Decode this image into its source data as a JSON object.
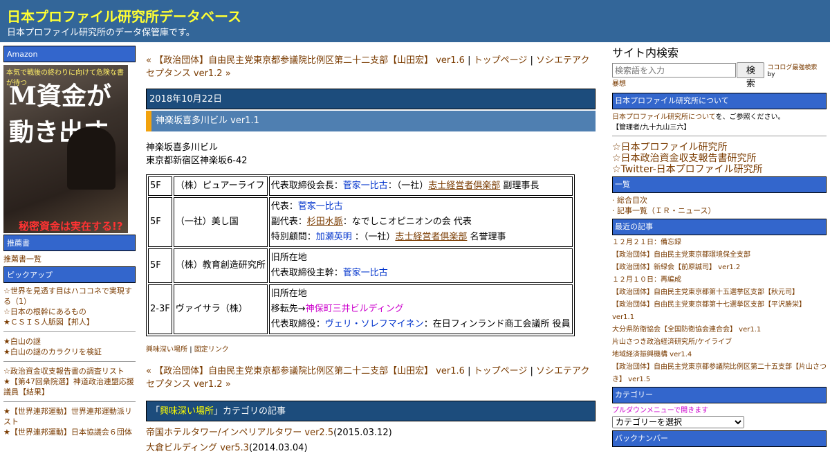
{
  "header": {
    "title": "日本プロファイル研究所データベース",
    "description": "日本プロファイル研究所のデータ保管庫です。"
  },
  "left_sidebar": {
    "amazon_heading": "Amazon",
    "book_cover": {
      "top_caption": "本気で戦後の終わりに向けて危険な書が待つ",
      "title": "M資金が動き出す",
      "bottom_caption": "秘密資金は実在する!?"
    },
    "recommend_heading": "推薦書",
    "recommend_link": "推薦書一覧",
    "pickup_heading": "ピックアップ",
    "pickup_group1": [
      "☆世界を見透す目はハココネで実現する（1）",
      "☆日本の根幹にあるもの",
      "★ＣＳＩＳ人脈図【邦人】"
    ],
    "pickup_group2": [
      "★白山の謎",
      "★白山の謎のカラクリを検証"
    ],
    "pickup_group3": [
      "☆政治資金収支報告書の調査リスト",
      "★【第47回衆院選】神道政治連盟応援議員【結果】"
    ],
    "pickup_group4": [
      "★【世界連邦運動】世界連邦運動派リスト",
      "★【世界連邦運動】日本協議会６団体"
    ]
  },
  "main": {
    "nav": {
      "prev_link": "« 【政治団体】自由民主党東京都参議院比例区第二十二支部【山田宏】 ver1.6",
      "separator": " | ",
      "top_link": "トップページ",
      "next_link": "ソシエテアクセプタンス ver1.2 »"
    },
    "date": "2018年10月22日",
    "entry_title": "神楽坂喜多川ビル ver1.1",
    "building_name": "神楽坂喜多川ビル",
    "address": "東京都新宿区神楽坂6-42",
    "rows": [
      {
        "floor": "5F",
        "tenant": "（株）ピュアーライフ",
        "lines": [
          {
            "parts": [
              {
                "t": "代表取締役会長："
              },
              {
                "t": "菅家一比古",
                "c": "blue"
              },
              {
                "t": "：（一社）"
              },
              {
                "t": "志士経営者倶楽部",
                "c": "brown"
              },
              {
                "t": " 副理事長"
              }
            ]
          }
        ]
      },
      {
        "floor": "5F",
        "tenant": "（一社）美し国",
        "lines": [
          {
            "parts": [
              {
                "t": "代表："
              },
              {
                "t": "菅家一比古",
                "c": "blue"
              }
            ]
          },
          {
            "parts": [
              {
                "t": "副代表："
              },
              {
                "t": "杉田水脈",
                "c": "brown"
              },
              {
                "t": "：なでしこオピニオンの会 代表"
              }
            ]
          },
          {
            "parts": [
              {
                "t": "特別顧問："
              },
              {
                "t": "加瀬英明",
                "c": "blue"
              },
              {
                "t": " ：（一社）"
              },
              {
                "t": "志士経営者倶楽部",
                "c": "brown"
              },
              {
                "t": " 名誉理事"
              }
            ]
          }
        ]
      },
      {
        "floor": "5F",
        "tenant": "（株）教育創造研究所",
        "lines": [
          {
            "parts": [
              {
                "t": "旧所在地"
              }
            ]
          },
          {
            "parts": [
              {
                "t": "代表取締役主幹："
              },
              {
                "t": "菅家一比古",
                "c": "blue"
              }
            ]
          }
        ]
      },
      {
        "floor": "2-3F",
        "tenant": "ヴァイサラ（株）",
        "lines": [
          {
            "parts": [
              {
                "t": "旧所在地"
              }
            ]
          },
          {
            "parts": [
              {
                "t": "移転先→"
              },
              {
                "t": "神保町三井ビルディング",
                "c": "magenta"
              }
            ]
          },
          {
            "parts": [
              {
                "t": "代表取締役："
              },
              {
                "t": "ヴェリ・ソレフマイネン",
                "c": "blue"
              },
              {
                "t": "：在日フィンランド商工会議所 役員"
              }
            ]
          }
        ]
      }
    ],
    "category_link": "興味深い場所",
    "permalink": "固定リンク",
    "category_bar_prefix": "「",
    "category_bar_link": "興味深い場所",
    "category_bar_suffix": "」カテゴリの記事",
    "category_items": [
      {
        "title": "帝国ホテルタワー/インペリアルタワー ver2.5",
        "date": "(2015.03.12)"
      },
      {
        "title": "大倉ビルディング ver5.3",
        "date": "(2014.03.04)"
      }
    ]
  },
  "right_sidebar": {
    "search_title": "サイト内検索",
    "search_placeholder": "検索語を入力",
    "search_button": "検索",
    "search_credit_link": "ココログ最強検索",
    "search_credit_by": " by ",
    "search_credit_author": "暴想",
    "about_heading": "日本プロファイル研究所について",
    "about_link": "日本プロファイル研究所について",
    "about_text": "を、ご参照ください。",
    "admin_text": "【管理者/九十九山三六】",
    "big_links": [
      "☆日本プロファイル研究所",
      "☆日本政治資金収支報告書研究所",
      "☆Twitter-日本プロファイル研究所"
    ],
    "list_heading": "一覧",
    "list_items": [
      "総合目次",
      "記事一覧（ＩＲ・ニュース）"
    ],
    "recent_heading": "最近の記事",
    "recent_items": [
      "１２月２１日：備忘録",
      "【政治団体】自由民主党東京都環境保全支部",
      "【政治団体】新緑会【前原誠司】 ver1.2",
      "１２月１０日：再編成",
      "【政治団体】自由民主党東京都第十五選挙区支部【秋元司】",
      "【政治団体】自由民主党東京都第十七選挙区支部【平沢勝栄】 ver1.1",
      "大分県防衛協会【全国防衛協会連合会】 ver1.1",
      "片山さつき政治経済研究所/ケイライブ",
      "地域経済振興機構 ver1.4",
      "【政治団体】自由民主党東京都参議院比例区第二十五支部【片山さつき】 ver1.5"
    ],
    "category_heading": "カテゴリー",
    "category_note": "プルダウンメニューで開きます",
    "category_select": "カテゴリーを選択",
    "backnumber_heading": "バックナンバー"
  }
}
